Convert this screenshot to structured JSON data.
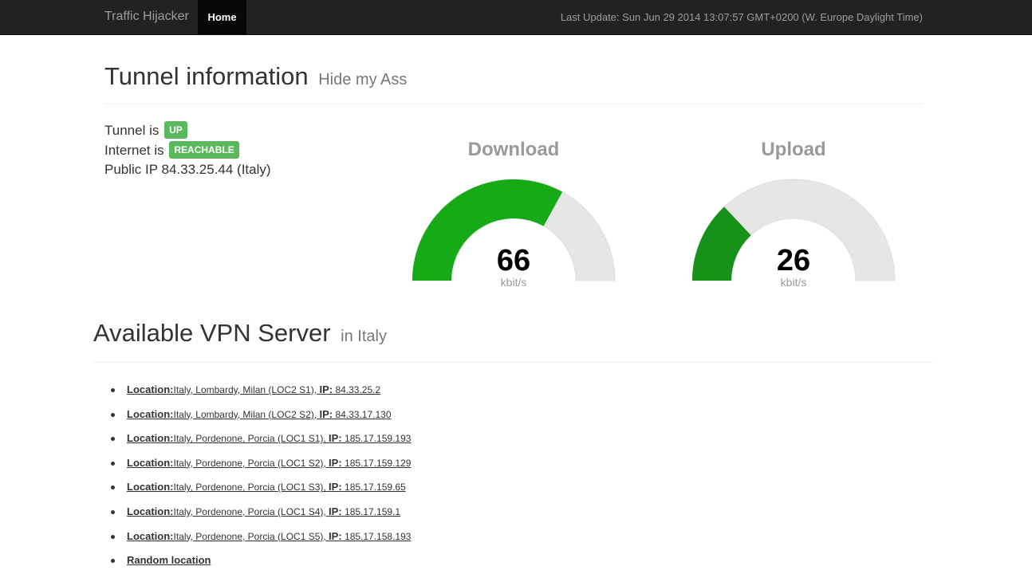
{
  "navbar": {
    "brand": "Traffic Hijacker",
    "home_label": "Home",
    "last_update": "Last Update: Sun Jun 29 2014 13:07:57 GMT+0200 (W. Europe Daylight Time)"
  },
  "tunnel": {
    "title": "Tunnel information",
    "subtitle": "Hide my Ass",
    "tunnel_label": "Tunnel is",
    "tunnel_status": "UP",
    "internet_label": "Internet is",
    "internet_status": "REACHABLE",
    "public_ip_text": "Public IP 84.33.25.44 (Italy)",
    "badge_color": "#5cb85c"
  },
  "gauges": {
    "download": {
      "title": "Download",
      "value": 66,
      "value_text": "66",
      "unit": "kbit/s",
      "fill_fraction": 0.66,
      "color": "#16ab16"
    },
    "upload": {
      "title": "Upload",
      "value": 26,
      "value_text": "26",
      "unit": "kbit/s",
      "fill_fraction": 0.26,
      "color": "#16921a"
    },
    "track_color": "#e6e6e6"
  },
  "servers": {
    "title": "Available VPN Server",
    "subtitle": "in Italy",
    "location_label": "Location:",
    "ip_label": "IP:",
    "items": [
      {
        "location": "Italy, Lombardy, Milan (LOC2 S1),",
        "ip": "84.33.25.2"
      },
      {
        "location": "Italy, Lombardy, Milan (LOC2 S2),",
        "ip": "84.33.17.130"
      },
      {
        "location": "Italy, Pordenone, Porcia (LOC1 S1),",
        "ip": "185.17.159.193"
      },
      {
        "location": "Italy, Pordenone, Porcia (LOC1 S2),",
        "ip": "185.17.159.129"
      },
      {
        "location": "Italy, Pordenone, Porcia (LOC1 S3),",
        "ip": "185.17.159.65"
      },
      {
        "location": "Italy, Pordenone, Porcia (LOC1 S4),",
        "ip": "185.17.159.1"
      },
      {
        "location": "Italy, Pordenone, Porcia (LOC1 S5),",
        "ip": "185.17.158.193"
      }
    ],
    "random_label": "Random location"
  }
}
